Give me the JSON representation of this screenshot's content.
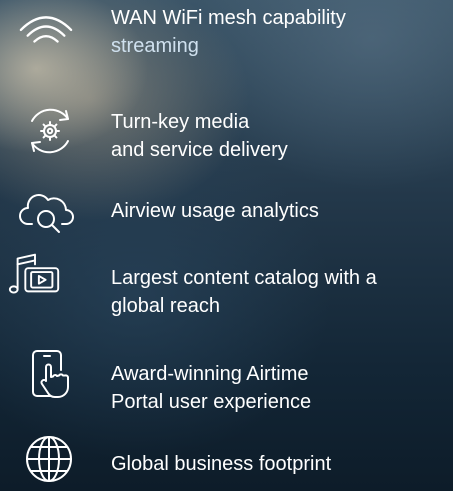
{
  "features": [
    {
      "icon": "wifi-icon",
      "lines": [
        "WAN WiFi mesh capability",
        "streaming"
      ]
    },
    {
      "icon": "gear-cycle-icon",
      "lines": [
        "Turn-key media",
        "and service delivery"
      ]
    },
    {
      "icon": "cloud-search-icon",
      "lines": [
        "Airview usage analytics"
      ]
    },
    {
      "icon": "music-video-icon",
      "lines": [
        "Largest content catalog with a",
        "global reach"
      ]
    },
    {
      "icon": "touch-phone-icon",
      "lines": [
        "Award-winning Airtime",
        "Portal user experience"
      ]
    },
    {
      "icon": "globe-icon",
      "lines": [
        "Global business footprint"
      ]
    }
  ]
}
